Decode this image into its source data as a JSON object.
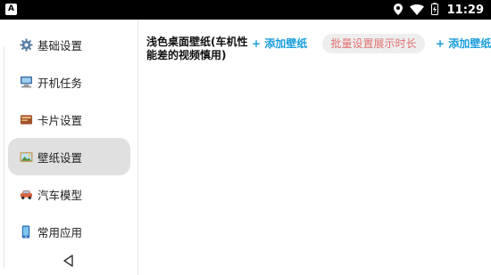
{
  "status_bar": {
    "app_icon_letter": "A",
    "time": "11:29",
    "icons": [
      "location-icon",
      "wifi-icon",
      "battery-icon"
    ]
  },
  "sidebar": {
    "items": [
      {
        "label": "基础设置",
        "icon": "gear-icon",
        "active": false
      },
      {
        "label": "开机任务",
        "icon": "computer-icon",
        "active": false
      },
      {
        "label": "卡片设置",
        "icon": "card-icon",
        "active": false
      },
      {
        "label": "壁纸设置",
        "icon": "wallpaper-icon",
        "active": true
      },
      {
        "label": "汽车模型",
        "icon": "car-icon",
        "active": false
      },
      {
        "label": "常用应用",
        "icon": "phone-icon",
        "active": false
      }
    ]
  },
  "main": {
    "light_wallpaper_title": "浅色桌面壁纸(车机性能差的视频慎用)",
    "add_wallpaper_link": "+ 添加壁纸",
    "batch_duration_button": "批量设置展示时长",
    "add_wallpaper_link_2": "+ 添加壁纸"
  },
  "colors": {
    "accent_link": "#1a9ede",
    "pill_text": "#e07070",
    "active_item_bg": "#e0e0e0"
  }
}
